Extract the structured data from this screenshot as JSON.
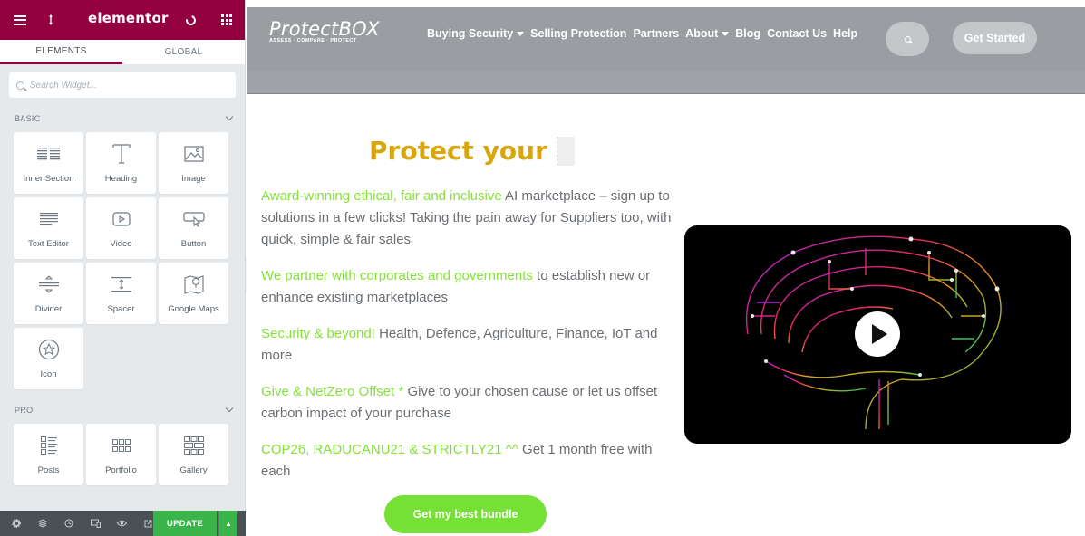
{
  "editor": {
    "brand": "elementor",
    "tabs": [
      {
        "label": "ELEMENTS",
        "active": true
      },
      {
        "label": "GLOBAL",
        "active": false
      }
    ],
    "search_placeholder": "Search Widget...",
    "sections": [
      {
        "title": "BASIC",
        "widgets": [
          {
            "label": "Inner Section",
            "icon": "inner-section-icon"
          },
          {
            "label": "Heading",
            "icon": "heading-icon"
          },
          {
            "label": "Image",
            "icon": "image-icon"
          },
          {
            "label": "Text Editor",
            "icon": "text-editor-icon"
          },
          {
            "label": "Video",
            "icon": "video-icon"
          },
          {
            "label": "Button",
            "icon": "button-icon"
          },
          {
            "label": "Divider",
            "icon": "divider-icon"
          },
          {
            "label": "Spacer",
            "icon": "spacer-icon"
          },
          {
            "label": "Google Maps",
            "icon": "google-maps-icon"
          },
          {
            "label": "Icon",
            "icon": "star-icon"
          }
        ]
      },
      {
        "title": "PRO",
        "widgets": [
          {
            "label": "Posts",
            "icon": "posts-icon"
          },
          {
            "label": "Portfolio",
            "icon": "portfolio-icon"
          },
          {
            "label": "Gallery",
            "icon": "gallery-icon"
          }
        ]
      }
    ],
    "update_label": "UPDATE",
    "accent_color": "#93003f",
    "update_color": "#39b54a"
  },
  "site": {
    "logo": {
      "text": "ProtectBOX",
      "tagline": "ASSESS · COMPARE · PROTECT"
    },
    "nav": [
      {
        "label": "Buying Security",
        "dropdown": true
      },
      {
        "label": "Selling Protection",
        "dropdown": false
      },
      {
        "label": "Partners",
        "dropdown": false
      },
      {
        "label": "About",
        "dropdown": true
      },
      {
        "label": "Blog",
        "dropdown": false
      },
      {
        "label": "Contact Us",
        "dropdown": false
      },
      {
        "label": "Help",
        "dropdown": false
      }
    ],
    "get_started": "Get Started",
    "hero_title": "Protect your",
    "paragraphs": [
      {
        "highlight": "Award-winning ethical, fair and inclusive",
        "text": " AI marketplace – sign up to solutions in a few clicks! Taking the pain away for Suppliers too, with quick, simple & fair sales"
      },
      {
        "highlight": "We partner with corporates and governments",
        "text": " to establish new or enhance existing marketplaces"
      },
      {
        "highlight": "Security & beyond!",
        "text": " Health, Defence, Agriculture, Finance, IoT and more"
      },
      {
        "highlight": "Give & NetZero Offset *",
        "text": " Give to your chosen cause or let us offset carbon impact of your purchase"
      },
      {
        "highlight": "COP26, RADUCANU21 & STRICTLY21 ^^",
        "text": " Get 1 month free with each"
      }
    ],
    "cta": "Get my best bundle",
    "title_color": "#d9a60e",
    "highlight_color": "#86e03b",
    "cta_color": "#75e134"
  }
}
